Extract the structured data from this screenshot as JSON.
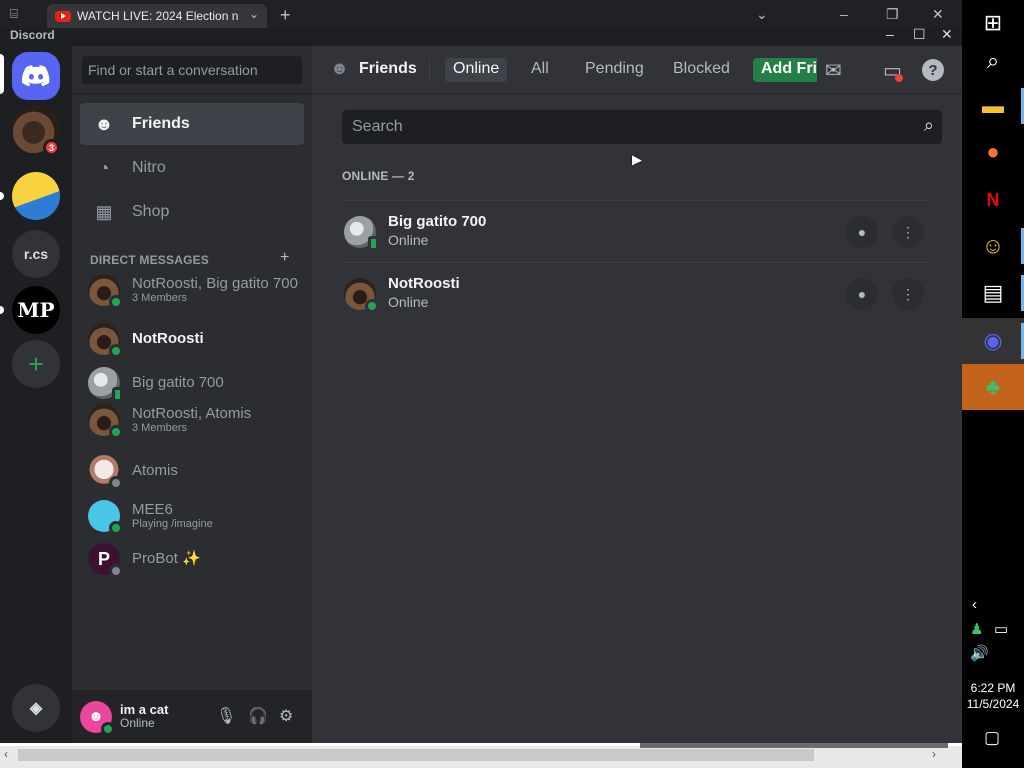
{
  "browser": {
    "tab_title": "WATCH LIVE: 2024 Election n",
    "tab_close": "⌄",
    "new_tab": "+",
    "dropdown": "⌄",
    "minimize": "–",
    "restore": "❐",
    "close": "✕"
  },
  "app": {
    "title": "Discord",
    "minimize": "–",
    "maximize": "☐",
    "close": "✕"
  },
  "servers": [
    {
      "name": "home",
      "label": ""
    },
    {
      "name": "cat-server",
      "badge": "3"
    },
    {
      "name": "yellow-server",
      "label": ""
    },
    {
      "name": "rcs-server",
      "label": "r.cs"
    },
    {
      "name": "mp-server",
      "label": "MP"
    },
    {
      "name": "add-server",
      "label": "+"
    }
  ],
  "sidebar": {
    "search_placeholder": "Find or start a conversation",
    "nav": [
      {
        "label": "Friends",
        "icon": "friends-icon"
      },
      {
        "label": "Nitro",
        "icon": "nitro-icon"
      },
      {
        "label": "Shop",
        "icon": "shop-icon"
      }
    ],
    "dm_header": "DIRECT MESSAGES",
    "dm_add": "+",
    "dms": [
      {
        "name": "NotRoosti, Big gatito 700",
        "sub": "3 Members"
      },
      {
        "name": "NotRoosti",
        "sub": ""
      },
      {
        "name": "Big gatito 700",
        "sub": ""
      },
      {
        "name": "NotRoosti, Atomis",
        "sub": "3 Members"
      },
      {
        "name": "Atomis",
        "sub": ""
      },
      {
        "name": "MEE6",
        "sub": "Playing /imagine"
      },
      {
        "name": "ProBot ✨",
        "sub": ""
      }
    ]
  },
  "user": {
    "name": "im a cat",
    "status": "Online"
  },
  "topbar": {
    "title": "Friends",
    "tabs": [
      "Online",
      "All",
      "Pending",
      "Blocked"
    ],
    "add_friend": "Add Friend",
    "help": "?"
  },
  "friends": {
    "search_placeholder": "Search",
    "online_header": "ONLINE — 2",
    "list": [
      {
        "name": "Big gatito 700",
        "status": "Online"
      },
      {
        "name": "NotRoosti",
        "status": "Online"
      }
    ]
  },
  "taskbar": {
    "time": "6:22 PM",
    "date": "11/5/2024"
  }
}
